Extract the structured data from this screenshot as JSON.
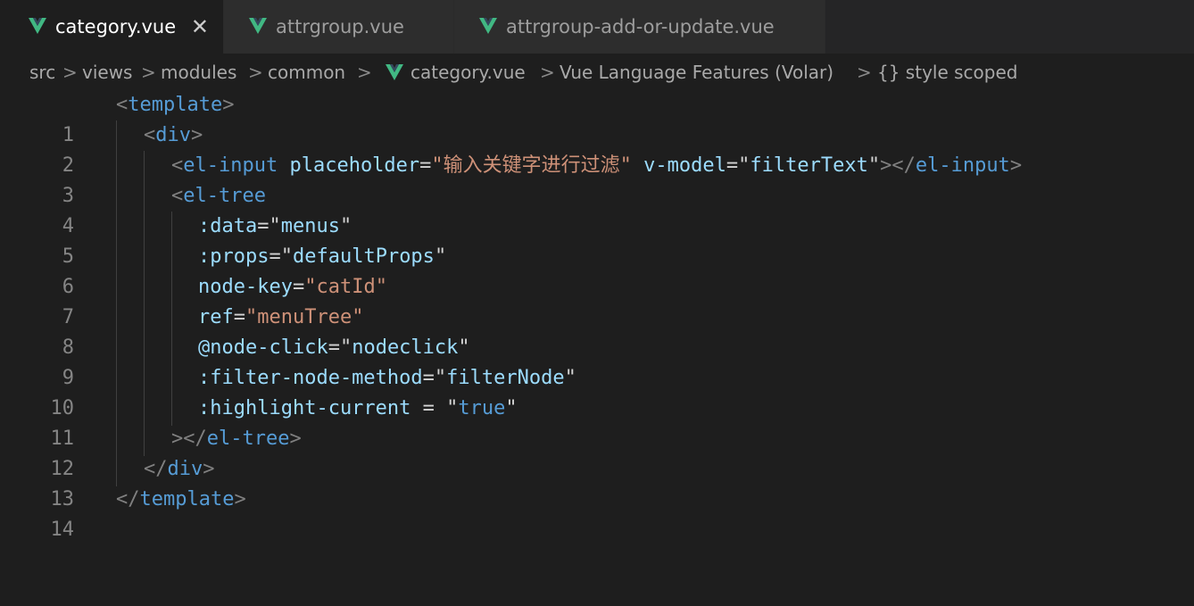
{
  "tabs": [
    {
      "label": "category.vue",
      "active": true,
      "close": "✕"
    },
    {
      "label": "attrgroup.vue",
      "active": false
    },
    {
      "label": "attrgroup-add-or-update.vue",
      "active": false
    }
  ],
  "breadcrumb": {
    "items": [
      "src",
      "views",
      "modules",
      "common",
      "category.vue",
      "Vue Language Features (Volar)",
      "{} style scoped"
    ],
    "separator": ">"
  },
  "colors": {
    "tag": "#569cd6",
    "attribute": "#9cdcfe",
    "string": "#ce9178",
    "punctuation": "#808080",
    "vue_icon": "#41b883"
  },
  "lines": [
    {
      "n": "1",
      "text": "<template>"
    },
    {
      "n": "2",
      "text": "<div>"
    },
    {
      "n": "3",
      "text": "<el-input placeholder=\"输入关键字进行过滤\" v-model=\"filterText\"></el-input>"
    },
    {
      "n": "4",
      "text": "<el-tree"
    },
    {
      "n": "5",
      "text": ":data=\"menus\""
    },
    {
      "n": "6",
      "text": ":props=\"defaultProps\""
    },
    {
      "n": "7",
      "text": "node-key=\"catId\""
    },
    {
      "n": "8",
      "text": "ref=\"menuTree\""
    },
    {
      "n": "9",
      "text": "@node-click=\"nodeclick\""
    },
    {
      "n": "10",
      "text": ":filter-node-method=\"filterNode\""
    },
    {
      "n": "11",
      "text": ":highlight-current = \"true\""
    },
    {
      "n": "12",
      "text": "></el-tree>"
    },
    {
      "n": "13",
      "text": "</div>"
    },
    {
      "n": "14",
      "text": "</template>"
    }
  ]
}
